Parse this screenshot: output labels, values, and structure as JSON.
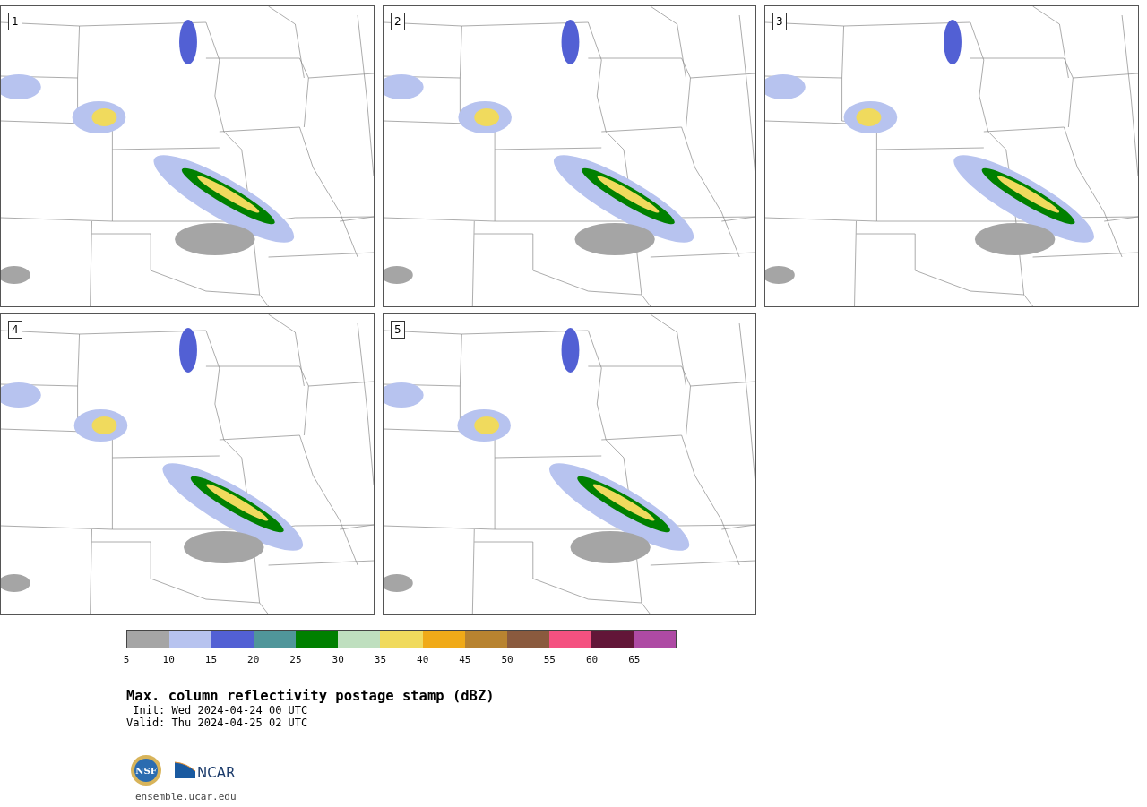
{
  "panels": [
    {
      "label": "1"
    },
    {
      "label": "2"
    },
    {
      "label": "3"
    },
    {
      "label": "4"
    },
    {
      "label": "5"
    }
  ],
  "colorbar": [
    {
      "color": "#a5a5a5",
      "label": "5"
    },
    {
      "color": "#b7c3ef",
      "label": "10"
    },
    {
      "color": "#5260d4",
      "label": "15"
    },
    {
      "color": "#50969a",
      "label": "20"
    },
    {
      "color": "#008000",
      "label": "25"
    },
    {
      "color": "#bfdfbf",
      "label": "30"
    },
    {
      "color": "#f0da5d",
      "label": "35"
    },
    {
      "color": "#f0aa18",
      "label": "40"
    },
    {
      "color": "#b88330",
      "label": "45"
    },
    {
      "color": "#8a5a3e",
      "label": "50"
    },
    {
      "color": "#f45180",
      "label": "55"
    },
    {
      "color": "#621638",
      "label": "60"
    },
    {
      "color": "#ae4aa4",
      "label": "65"
    }
  ],
  "title": "Max. column reflectivity postage stamp (dBZ)",
  "init": " Init: Wed 2024-04-24 00 UTC",
  "valid": "Valid: Thu 2024-04-25 02 UTC",
  "logos": {
    "nsf": "NSF",
    "ncar": "NCAR"
  },
  "link": "ensemble.ucar.edu"
}
